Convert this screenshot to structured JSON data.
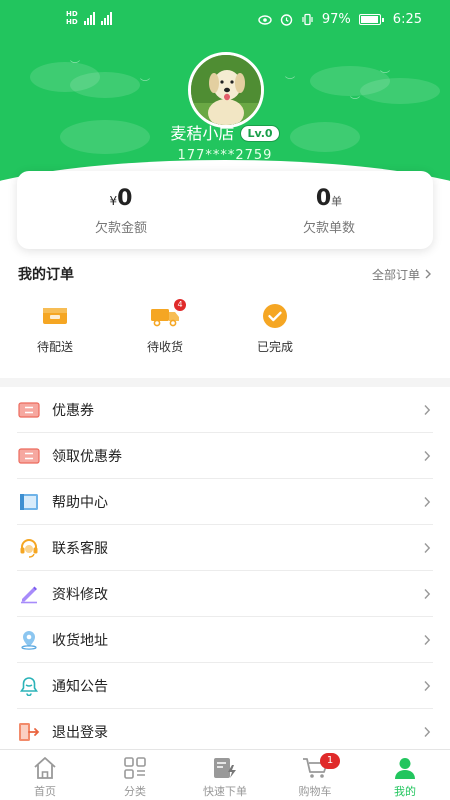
{
  "statusbar": {
    "battery": "97%",
    "time": "6:25"
  },
  "profile": {
    "shop_name": "麦秸小店",
    "level": "Lv.0",
    "phone": "177****2759"
  },
  "debt": {
    "currency": "¥",
    "amount": "0",
    "amount_label": "欠款金额",
    "count": "0",
    "count_unit": "单",
    "count_label": "欠款单数"
  },
  "orders": {
    "title": "我的订单",
    "all_label": "全部订单",
    "items": [
      {
        "label": "待配送",
        "icon": "box-icon"
      },
      {
        "label": "待收货",
        "icon": "truck-icon",
        "badge": "4"
      },
      {
        "label": "已完成",
        "icon": "check-icon"
      }
    ]
  },
  "menu": [
    {
      "label": "优惠券",
      "icon": "coupon-icon"
    },
    {
      "label": "领取优惠券",
      "icon": "coupon-receive-icon"
    },
    {
      "label": "帮助中心",
      "icon": "book-icon"
    },
    {
      "label": "联系客服",
      "icon": "headset-icon"
    },
    {
      "label": "资料修改",
      "icon": "pencil-icon"
    },
    {
      "label": "收货地址",
      "icon": "location-icon"
    },
    {
      "label": "通知公告",
      "icon": "bell-icon"
    },
    {
      "label": "退出登录",
      "icon": "logout-icon"
    }
  ],
  "tabs": [
    {
      "label": "首页",
      "icon": "home-icon"
    },
    {
      "label": "分类",
      "icon": "category-icon"
    },
    {
      "label": "快速下单",
      "icon": "quick-order-icon"
    },
    {
      "label": "购物车",
      "icon": "cart-icon",
      "badge": "1"
    },
    {
      "label": "我的",
      "icon": "user-icon",
      "active": true
    }
  ],
  "colors": {
    "brand": "#22c55e",
    "badge": "#e02a2a",
    "orange": "#f5a623"
  }
}
